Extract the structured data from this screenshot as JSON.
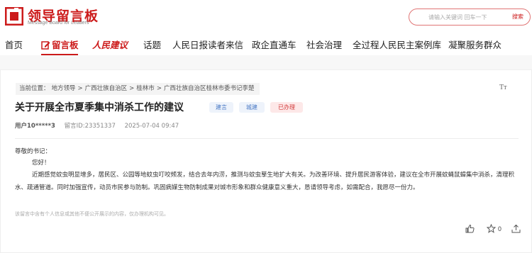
{
  "logo": {
    "title": "领导留言板",
    "subtitle": "Message Board for Leaders"
  },
  "search": {
    "placeholder": "请输入关键词 回车一下",
    "button_label": "搜索"
  },
  "nav": {
    "items": [
      {
        "label": "首页"
      },
      {
        "label": "留言板"
      },
      {
        "label": "人民建议"
      },
      {
        "label": "话题"
      },
      {
        "label": "人民日报读者来信"
      },
      {
        "label": "政企直通车"
      },
      {
        "label": "社会治理"
      },
      {
        "label": "全过程人民民主案例库"
      },
      {
        "label": "凝聚服务群众"
      }
    ]
  },
  "breadcrumb": {
    "prefix": "当前位置：",
    "items": [
      "地方领导",
      ">",
      "广西壮族自治区",
      ">",
      "桂林市",
      ">",
      "广西壮族自治区桂林市委书记李楚"
    ]
  },
  "font_toggle": "Tт",
  "post": {
    "title": "关于开展全市夏季集中消杀工作的建议",
    "tags": [
      "建言",
      "城建",
      "已办理"
    ],
    "user": "用户10*****3",
    "message_id": "留言ID:23351337",
    "date": "2025-07-04 09:47",
    "salutation": "尊敬的书记：",
    "greeting": "您好！",
    "body": "近期感觉蚊虫明显增多，居民区、公园等地蚊虫叮咬频发，结合去年内涝，推测与蚊虫孳生地扩大有关。为改善环境、提升居民游客体验，建议在全市开展蚊蝇鼠蟑集中消杀，清理积水、疏通管道。同时加强宣传，动员市民参与防制。巩固病媒生物防制成果对城市形象和群众健康意义重大，恳请领导考虑，如需配合，我愿尽一份力。",
    "disclaimer": "该留言中含有个人信息或其他不便公开展示的内容，仅办理机构可见。",
    "like_count": "",
    "star_count": "0"
  },
  "colors": {
    "brand_red": "#cc1b1b",
    "tag_blue": "#4a7ac5",
    "tag_red": "#d23b3b"
  },
  "icons": [
    "logo-mark-icon",
    "edit-icon",
    "thumbs-up-icon",
    "star-icon",
    "share-icon"
  ]
}
